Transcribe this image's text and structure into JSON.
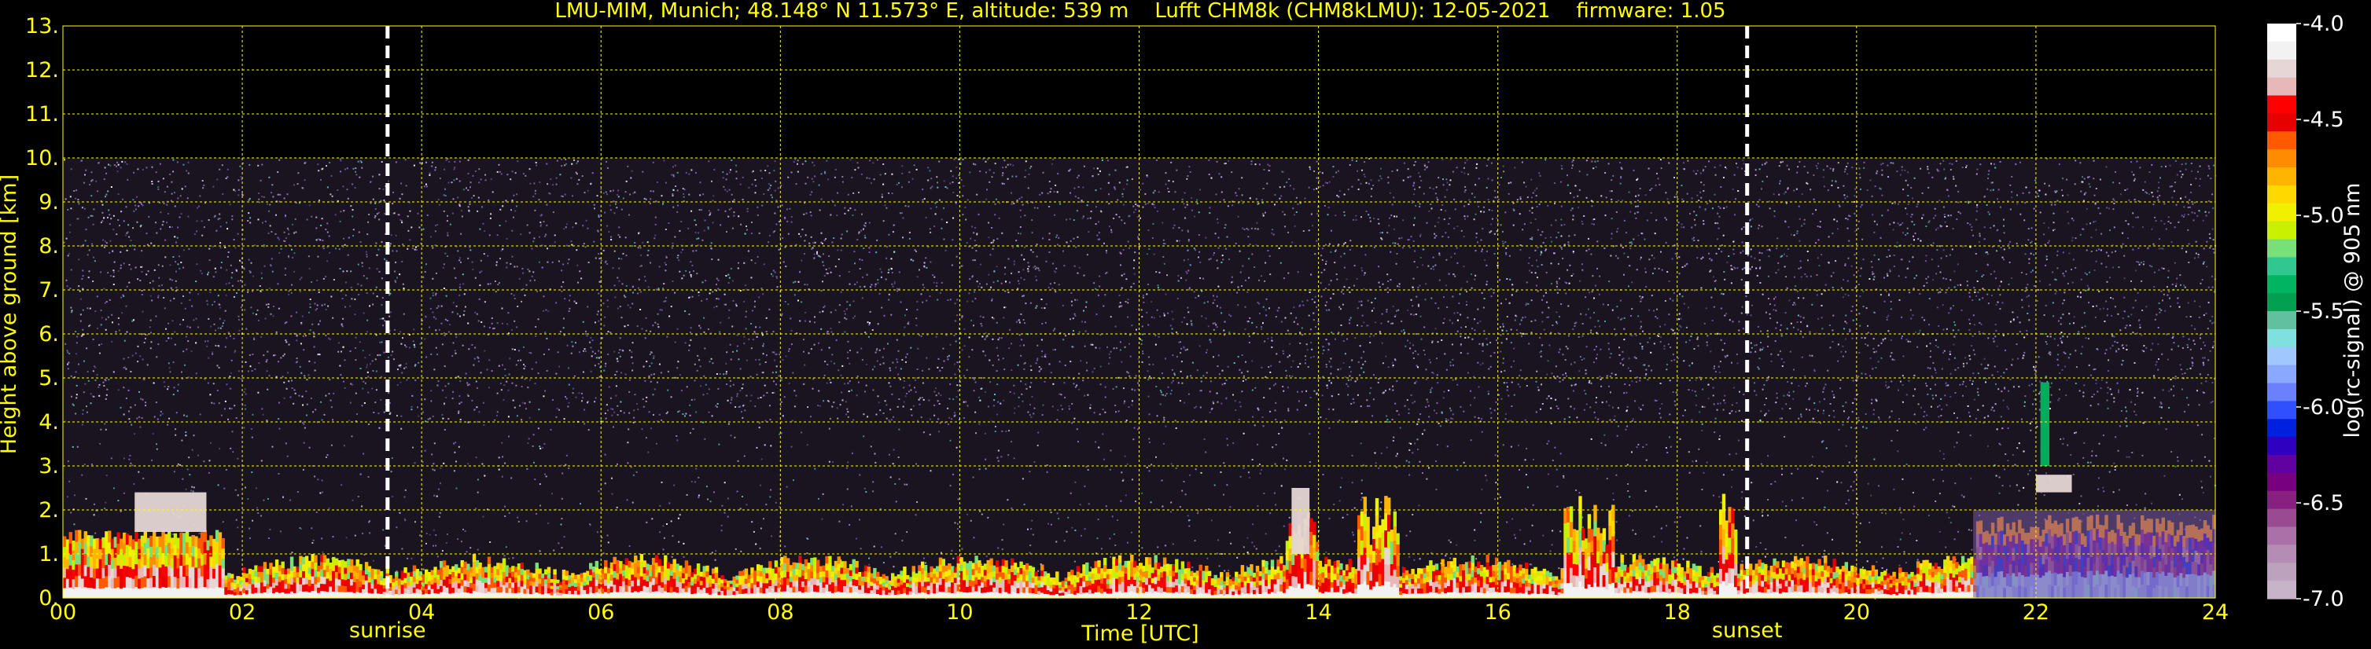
{
  "chart_data": {
    "type": "heatmap",
    "title": "LMU-MIM, Munich; 48.148° N 11.573° E, altitude: 539 m    Lufft CHM8k (CHM8kLMU): 12-05-2021    firmware: 1.05",
    "xlabel": "Time [UTC]",
    "ylabel": "Height above ground [km]",
    "xlim": [
      0,
      24
    ],
    "ylim": [
      0,
      13
    ],
    "x_ticks": [
      "00",
      "02",
      "04",
      "06",
      "08",
      "10",
      "12",
      "14",
      "16",
      "18",
      "20",
      "22",
      "24"
    ],
    "y_ticks": [
      "0.",
      "1.",
      "2.",
      "3.",
      "4.",
      "5.",
      "6.",
      "7.",
      "8.",
      "9.",
      "10.",
      "11.",
      "12.",
      "13."
    ],
    "grid": true,
    "signal_top_km": 10,
    "markers": [
      {
        "label": "sunrise",
        "time": 3.62
      },
      {
        "label": "sunset",
        "time": 18.78
      }
    ],
    "colorbar": {
      "label": "log(rc-signal) @ 905 nm",
      "range": [
        -7.0,
        -4.0
      ],
      "ticks": [
        "-4.0",
        "-4.5",
        "-5.0",
        "-5.5",
        "-6.0",
        "-6.5",
        "-7.0"
      ],
      "colors": [
        "#ffffff",
        "#f2f2f2",
        "#e6d6d6",
        "#e8b8b8",
        "#ff0000",
        "#e60000",
        "#ff5a00",
        "#ff8c00",
        "#ffb400",
        "#ffd800",
        "#f0f000",
        "#c8f000",
        "#78e078",
        "#30c890",
        "#00b460",
        "#00a050",
        "#60c0a0",
        "#80e0e0",
        "#a0c8ff",
        "#8aa8ff",
        "#6a80ff",
        "#3050ff",
        "#0020e0",
        "#3000c0",
        "#6000a0",
        "#780080",
        "#882080",
        "#9a4a90",
        "#ac70a8",
        "#b48cb4",
        "#bca2bc",
        "#c8b4c8"
      ]
    },
    "layers": [
      {
        "name": "background_noise",
        "from": 0,
        "to": 24,
        "height": [
          0,
          10
        ]
      },
      {
        "name": "boundary_layer",
        "from": 0,
        "to": 24,
        "height": [
          0,
          1.5
        ]
      },
      {
        "name": "cloud",
        "from": 0.8,
        "to": 1.6,
        "height": [
          1.5,
          2.4
        ]
      },
      {
        "name": "cloud",
        "from": 13.7,
        "to": 13.9,
        "height": [
          1.0,
          2.5
        ]
      },
      {
        "name": "cloud",
        "from": 22.0,
        "to": 22.4,
        "height": [
          2.4,
          2.8
        ]
      },
      {
        "name": "plume",
        "from": 22.05,
        "to": 22.15,
        "height": [
          3.0,
          4.9
        ]
      },
      {
        "name": "aerosol_layer",
        "from": 21.3,
        "to": 24,
        "height": [
          0,
          2.0
        ]
      }
    ]
  }
}
